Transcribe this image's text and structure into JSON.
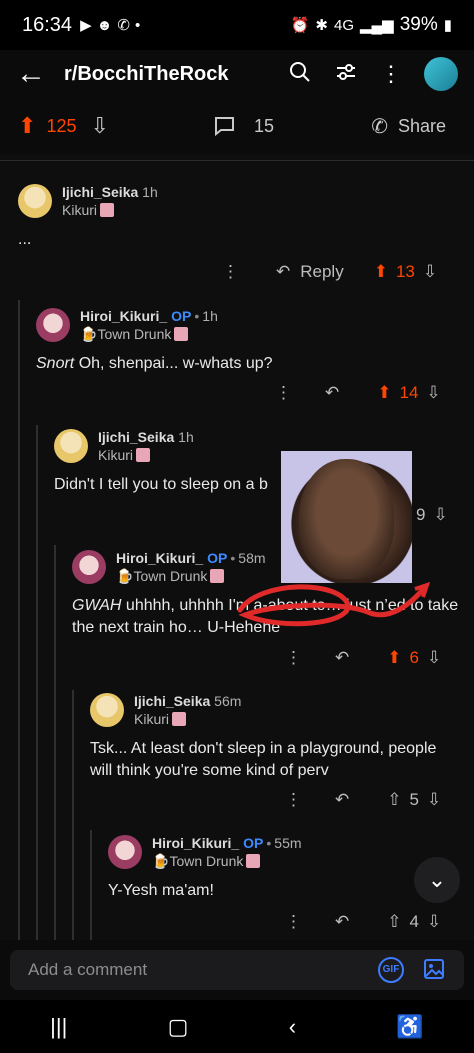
{
  "status": {
    "time": "16:34",
    "battery": "39%",
    "network": "4G",
    "icons": [
      "youtube-icon",
      "snapchat-icon",
      "whatsapp-icon",
      "dot-icon",
      "alarm-icon",
      "bluetooth-icon",
      "hd-icon",
      "signal-icon",
      "battery-icon"
    ]
  },
  "appbar": {
    "title": "r/BocchiTheRock",
    "icons": [
      "back-arrow-icon",
      "search-icon",
      "filter-icon",
      "more-vertical-icon",
      "user-avatar"
    ]
  },
  "post": {
    "upvotes": "125",
    "comments": "15",
    "share_label": "Share"
  },
  "comments": [
    {
      "author": "Ijichi_Seika",
      "op": "",
      "time": "1h",
      "flair": "Kikuri",
      "body": "...",
      "votes": "13",
      "reply_label": "Reply",
      "upvoted": true
    },
    {
      "author": "Hiroi_Kikuri_",
      "op": "OP",
      "time": "1h",
      "flair": "Town Drunk",
      "body_em": "Snort",
      "body": " Oh, shenpai... w-whats up?",
      "votes": "14",
      "upvoted": true
    },
    {
      "author": "Ijichi_Seika",
      "op": "",
      "time": "1h",
      "flair": "Kikuri",
      "body": "Didn't I tell you to sleep on a b",
      "votes": "9",
      "upvoted": false
    },
    {
      "author": "Hiroi_Kikuri_",
      "op": "OP",
      "time": "58m",
      "flair": "Town Drunk",
      "body_em": "GWAH",
      "body": " uhhhh, uhhhh I'm a-about to… just n’ed to take the next train ho… U-Hehehe",
      "votes": "6",
      "upvoted": true
    },
    {
      "author": "Ijichi_Seika",
      "op": "",
      "time": "56m",
      "flair": "Kikuri",
      "body": "Tsk... At least don't sleep in a playground, people will think you're some kind of perv",
      "votes": "5",
      "upvoted": false
    },
    {
      "author": "Hiroi_Kikuri_",
      "op": "OP",
      "time": "55m",
      "flair": "Town Drunk",
      "body": "Y-Yesh ma'am!",
      "votes": "4",
      "upvoted": false
    }
  ],
  "composer": {
    "placeholder": "Add a comment",
    "gif_label": "GIF"
  },
  "colors": {
    "upvote": "#ff4500",
    "op": "#3d8bff",
    "background": "#0e0e0f"
  }
}
